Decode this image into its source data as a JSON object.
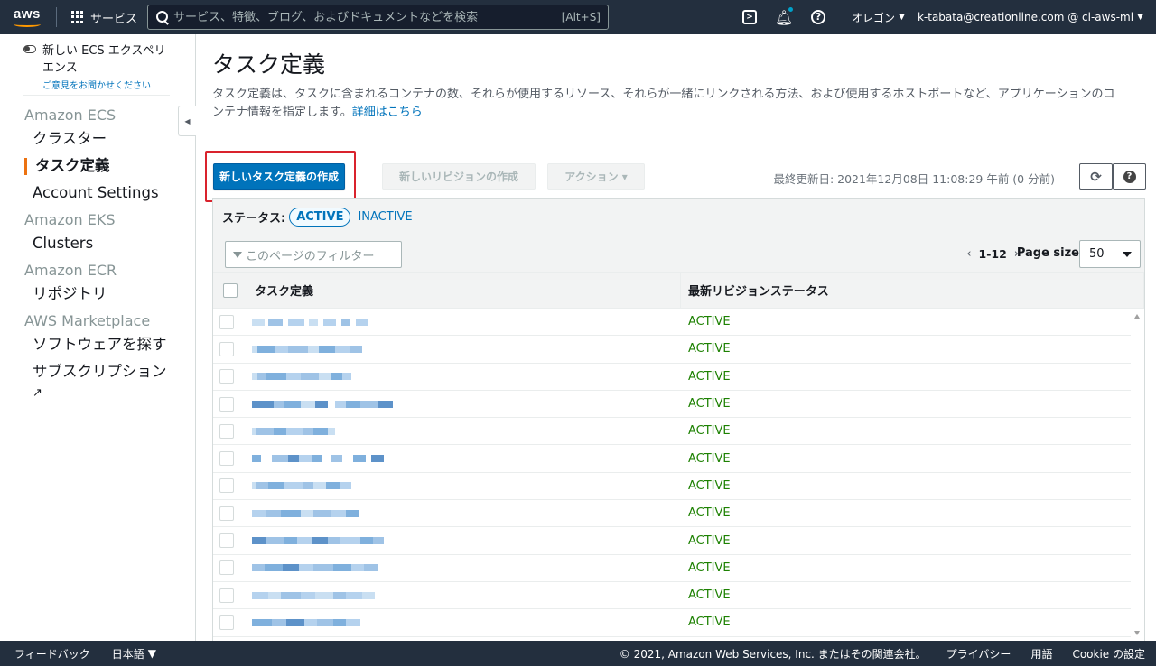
{
  "nav": {
    "logo": "aws",
    "services_label": "サービス",
    "search_placeholder": "サービス、特徴、ブログ、およびドキュメントなどを検索",
    "search_shortcut": "[Alt+S]",
    "region": "オレゴン",
    "account": "k-tabata@creationline.com @ cl-aws-ml",
    "icons": [
      "cloudshell-icon",
      "bell-icon",
      "help-icon"
    ]
  },
  "sidebar": {
    "new_experience": "新しい ECS エクスペリエンス",
    "feedback": "ご意見をお聞かせください",
    "groups": [
      {
        "title": "Amazon ECS",
        "items": [
          "クラスター",
          "タスク定義",
          "Account Settings"
        ]
      },
      {
        "title": "Amazon EKS",
        "items": [
          "Clusters"
        ]
      },
      {
        "title": "Amazon ECR",
        "items": [
          "リポジトリ"
        ]
      },
      {
        "title": "AWS Marketplace",
        "items": [
          "ソフトウェアを探す",
          "サブスクリプション"
        ]
      }
    ],
    "active_item": "タスク定義"
  },
  "page": {
    "title": "タスク定義",
    "description": "タスク定義は、タスクに含まれるコンテナの数、それらが使用するリソース、それらが一緒にリンクされる方法、および使用するホストポートなど、アプリケーションのコンテナ情報を指定します。",
    "learn_more": "詳細はこちら"
  },
  "toolbar": {
    "create_button": "新しいタスク定義の作成",
    "revision_button": "新しいリビジョンの作成",
    "actions_button": "アクション",
    "last_updated": "最終更新日: 2021年12月08日 11:08:29 午前 (0 分前)"
  },
  "status_filter": {
    "label": "ステータス:",
    "active": "ACTIVE",
    "inactive": "INACTIVE"
  },
  "filter": {
    "placeholder": "このページのフィルター"
  },
  "pagination": {
    "range": "1-12",
    "page_size_label": "Page size",
    "page_size": "50"
  },
  "table": {
    "columns": [
      "タスク定義",
      "最新リビジョンステータス"
    ],
    "rows": [
      {
        "status": "ACTIVE"
      },
      {
        "status": "ACTIVE"
      },
      {
        "status": "ACTIVE"
      },
      {
        "status": "ACTIVE"
      },
      {
        "status": "ACTIVE"
      },
      {
        "status": "ACTIVE"
      },
      {
        "status": "ACTIVE"
      },
      {
        "status": "ACTIVE"
      },
      {
        "status": "ACTIVE"
      },
      {
        "status": "ACTIVE"
      },
      {
        "status": "ACTIVE"
      },
      {
        "status": "ACTIVE"
      }
    ]
  },
  "footer": {
    "feedback": "フィードバック",
    "language": "日本語",
    "copyright": "© 2021, Amazon Web Services, Inc. またはその関連会社。",
    "privacy": "プライバシー",
    "terms": "用語",
    "cookie": "Cookie の設定"
  },
  "colors": {
    "nav_bg": "#232f3e",
    "primary": "#0073bb",
    "active_status": "#1d8102",
    "highlight": "#d9232d",
    "accent": "#ec7211"
  }
}
